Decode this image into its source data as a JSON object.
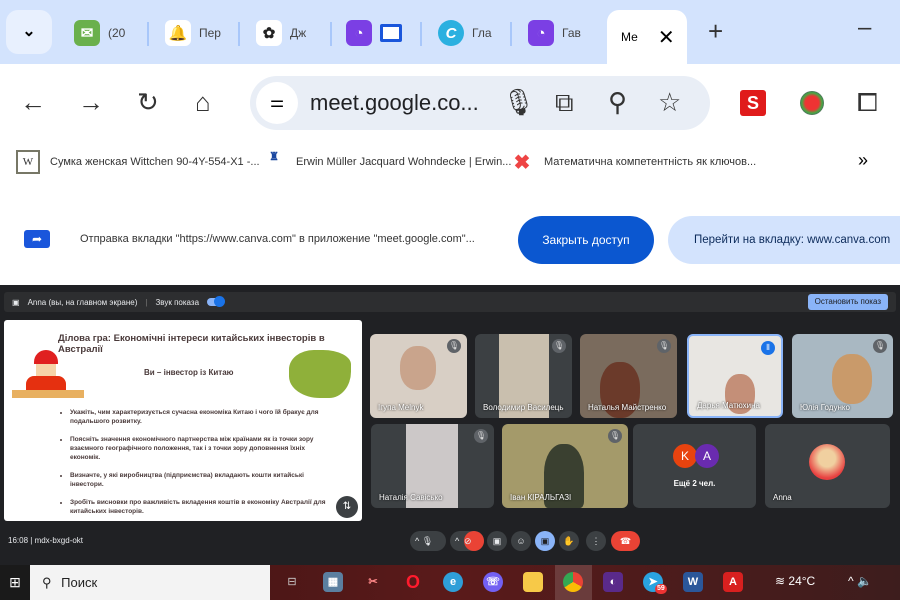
{
  "browser": {
    "tabs": [
      {
        "label": "(20"
      },
      {
        "label": "Пер"
      },
      {
        "label": "Дж"
      },
      {
        "label": ""
      },
      {
        "label": "Гла"
      },
      {
        "label": "Гав"
      }
    ],
    "active_tab": {
      "label": "Ме"
    },
    "url": "meet.google.co...",
    "bookmarks": [
      {
        "label": "Сумка женская Wittchen 90-4Y-554-X1 -..."
      },
      {
        "label": "Erwin Müller Jacquard Wohndecke | Erwin..."
      },
      {
        "label": "Математична компетентність як ключов..."
      }
    ],
    "accent": "#0b57d0"
  },
  "notification": {
    "text": "Отправка вкладки \"https://www.canva.com\" в приложение \"meet.google.com\"...",
    "close_access": "Закрыть доступ",
    "goto_tab": "Перейти на вкладку: www.canva.com"
  },
  "meet": {
    "presenter_label": "Anna (вы, на главном экране)",
    "sound_label": "Звук показа",
    "sound_on": true,
    "stop_button": "Остановить показ",
    "slide": {
      "title": "Ділова гра: Економічні інтереси китайських інвесторів в Австралії",
      "subtitle": "Ви – інвестор із Китаю",
      "bullets": [
        "Укажіть, чим характеризується сучасна економіка Китаю і чого їй бракує для подальшого розвитку.",
        "Поясніть значення економічного партнерства між країнами як із точки зору взаємного географічного положення, так і з точки зору доповнення їхніх економік.",
        "Визначте, у які виробництва (підприємства) вкладають кошти китайські інвестори.",
        "Зробіть висновки про важливість вкладення коштів в економіку Австралії для китайських інвесторів."
      ]
    },
    "participants": [
      {
        "name": "Ігупа Melnyk"
      },
      {
        "name": "Володимир Василець"
      },
      {
        "name": "Наталья Майстренко"
      },
      {
        "name": "Дарья Матюхина"
      },
      {
        "name": "Юлія Годунко"
      },
      {
        "name": "Наталія Савісько"
      },
      {
        "name": "Іван КІРАЛЬГАЗІ"
      }
    ],
    "more": {
      "text": "Ещё 2 чел.",
      "avatars": [
        "K",
        "A"
      ]
    },
    "self_name": "Anna",
    "time": "16:08",
    "meeting_code": "mdx-bxgd-okt"
  },
  "taskbar": {
    "search": "Поиск",
    "temperature": "24°C",
    "telegram_badge": "59"
  }
}
